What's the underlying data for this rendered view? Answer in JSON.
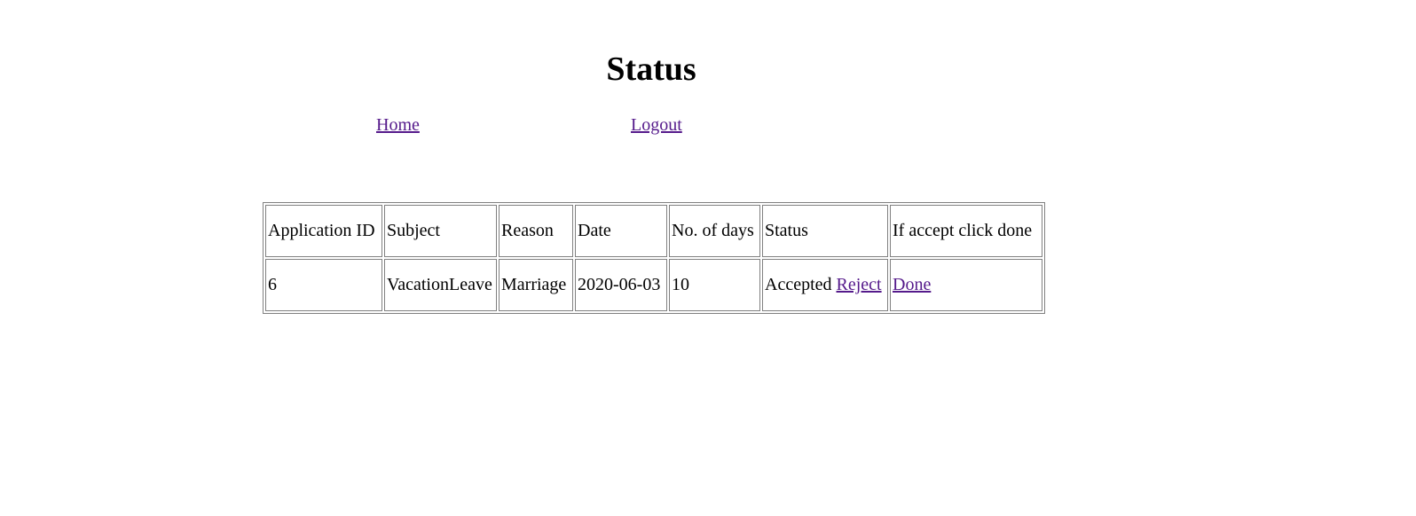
{
  "page": {
    "title": "Status"
  },
  "nav": {
    "home_label": "Home",
    "logout_label": "Logout"
  },
  "table": {
    "headers": {
      "application_id": "Application ID",
      "subject": "Subject",
      "reason": "Reason",
      "date": "Date",
      "days": "No. of days",
      "status": "Status",
      "action": "If accept click done"
    },
    "rows": [
      {
        "application_id": "6",
        "subject": "VacationLeave",
        "reason": "Marriage",
        "date": "2020-06-03",
        "days": "10",
        "status": "Accepted",
        "reject_label": "Reject",
        "done_label": "Done"
      }
    ]
  },
  "colors": {
    "visited_link": "#551a8b",
    "table_border": "#808080"
  }
}
